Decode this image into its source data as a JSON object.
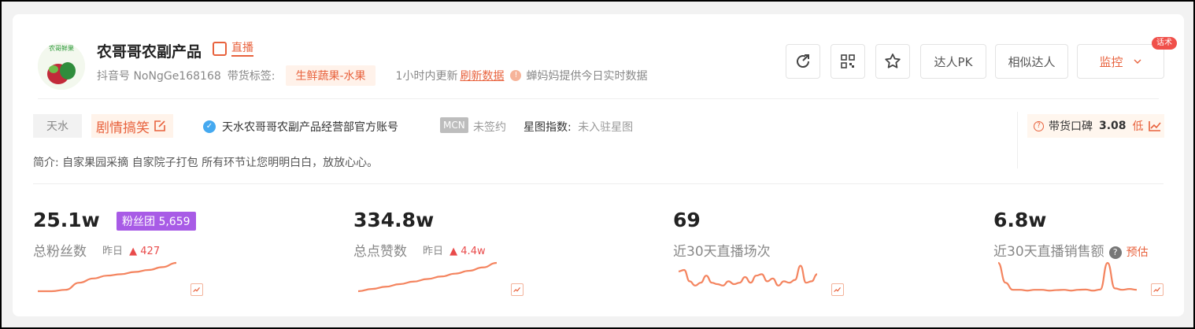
{
  "header": {
    "name": "农哥哥农副产品",
    "live_tag": "直播",
    "douyin_id": "抖音号 NoNgGe168168",
    "category_label": "带货标签:",
    "category": "生鲜蔬果-水果",
    "update_text": "1小时内更新",
    "refresh_label": "刷新数据",
    "realtime_text": "蝉妈妈提供今日实时数据",
    "pk_button": "达人PK",
    "similar_button": "相似达人",
    "monitor_button": "监控",
    "monitor_badge": "话术",
    "avatar_text": "农哥鲜果"
  },
  "profile": {
    "city": "天水",
    "genre": "剧情搞笑",
    "verified_text": "天水农哥哥农副产品经营部官方账号",
    "mcn_tag": "MCN",
    "mcn_value": "未签约",
    "star_label": "星图指数:",
    "star_value": "未入驻星图",
    "intro": "简介:  自家果园采摘 自家院子打包 所有环节让您明明白白，放放心心。",
    "rating_label": "带货口碑",
    "rating_score": "3.08",
    "rating_level": "低"
  },
  "stats": [
    {
      "value": "25.1w",
      "label": "总粉丝数",
      "yesterday_label": "昨日",
      "delta": "▲ 427",
      "badge": "粉丝团 5,659"
    },
    {
      "value": "334.8w",
      "label": "总点赞数",
      "yesterday_label": "昨日",
      "delta": "▲ 4.4w"
    },
    {
      "value": "69",
      "label": "近30天直播场次"
    },
    {
      "value": "6.8w",
      "label": "近30天直播销售额",
      "estimate": "预估"
    }
  ],
  "colors": {
    "accent": "#e8623d",
    "line": "#f4845f",
    "fans_badge": "#a85be6",
    "up": "#e94b4b"
  },
  "chart_data": [
    {
      "type": "line",
      "series": [
        {
          "values": [
            0,
            0,
            0.05,
            0.3,
            0.45,
            0.55,
            0.6,
            0.68,
            0.75,
            0.85,
            1.0
          ]
        }
      ]
    },
    {
      "type": "line",
      "series": [
        {
          "values": [
            0,
            0.08,
            0.16,
            0.25,
            0.34,
            0.43,
            0.52,
            0.62,
            0.72,
            0.84,
            1.0
          ]
        }
      ]
    },
    {
      "type": "line",
      "series": [
        {
          "values": [
            0.7,
            0.75,
            0.35,
            0.2,
            0.3,
            0.55,
            0.3,
            0.25,
            0.2,
            0.35,
            0.25,
            0.3,
            0.5,
            0.3,
            0.55,
            0.6,
            0.35,
            0.45,
            0.2,
            0.35,
            0.3,
            0.4,
            0.9,
            0.3,
            0.35,
            0.6
          ]
        }
      ]
    },
    {
      "type": "line",
      "series": [
        {
          "values": [
            1.0,
            0.3,
            0.05,
            0.05,
            0.02,
            0.05,
            0.05,
            0.02,
            0.04,
            0.05,
            0.02,
            0.05,
            0.06,
            0.02,
            0.06,
            1.0,
            0.1,
            0.05,
            0.08,
            0.05
          ]
        }
      ]
    }
  ]
}
